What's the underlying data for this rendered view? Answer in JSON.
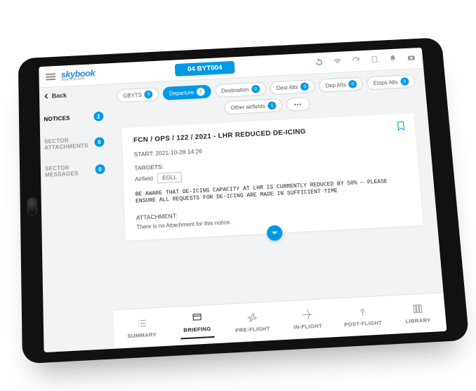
{
  "header": {
    "brand": "skybook",
    "brand_sub": "AVIATION EFB",
    "flight_code": "04 BYT004"
  },
  "back_label": "Back",
  "sidebar": {
    "items": [
      {
        "label": "NOTICES",
        "count": "2",
        "active": true
      },
      {
        "label": "SECTOR ATTACHMENTS",
        "count": "0",
        "active": false
      },
      {
        "label": "SECTOR MESSAGES",
        "count": "0",
        "active": false
      }
    ]
  },
  "filters": [
    {
      "label": "GBYTS",
      "count": "0",
      "active": false
    },
    {
      "label": "Departure",
      "count": "1",
      "active": true
    },
    {
      "label": "Destination",
      "count": "0",
      "active": false
    },
    {
      "label": "Dest Alts",
      "count": "0",
      "active": false
    },
    {
      "label": "Dep Alts",
      "count": "0",
      "active": false
    },
    {
      "label": "Etops Alts",
      "count": "0",
      "active": false
    },
    {
      "label": "Other airfields",
      "count": "1",
      "active": false
    }
  ],
  "notice": {
    "title": "FCN / OPS / 122 / 2021 - LHR REDUCED DE-ICING",
    "start_label": "START:",
    "start_value": "2021-10-28 14:26",
    "targets_label": "TARGETS:",
    "target_field_label": "Airfield",
    "target_field_value": "EGLL",
    "body": "BE AWARE THAT DE-ICING CAPACITY AT LHR IS CURRENTLY REDUCED BY 50% — PLEASE ENSURE ALL REQUESTS FOR DE-ICING ARE MADE IN SUFFICIENT TIME",
    "attachment_label": "ATTACHMENT:",
    "attachment_text": "There is no Attachment for this notice."
  },
  "bottom_nav": [
    {
      "label": "SUMMARY",
      "icon": "list"
    },
    {
      "label": "BRIEFING",
      "icon": "briefing",
      "active": true
    },
    {
      "label": "PRE-FLIGHT",
      "icon": "preflight"
    },
    {
      "label": "IN-FLIGHT",
      "icon": "inflight"
    },
    {
      "label": "POST-FLIGHT",
      "icon": "postflight"
    },
    {
      "label": "LIBRARY",
      "icon": "library"
    }
  ]
}
